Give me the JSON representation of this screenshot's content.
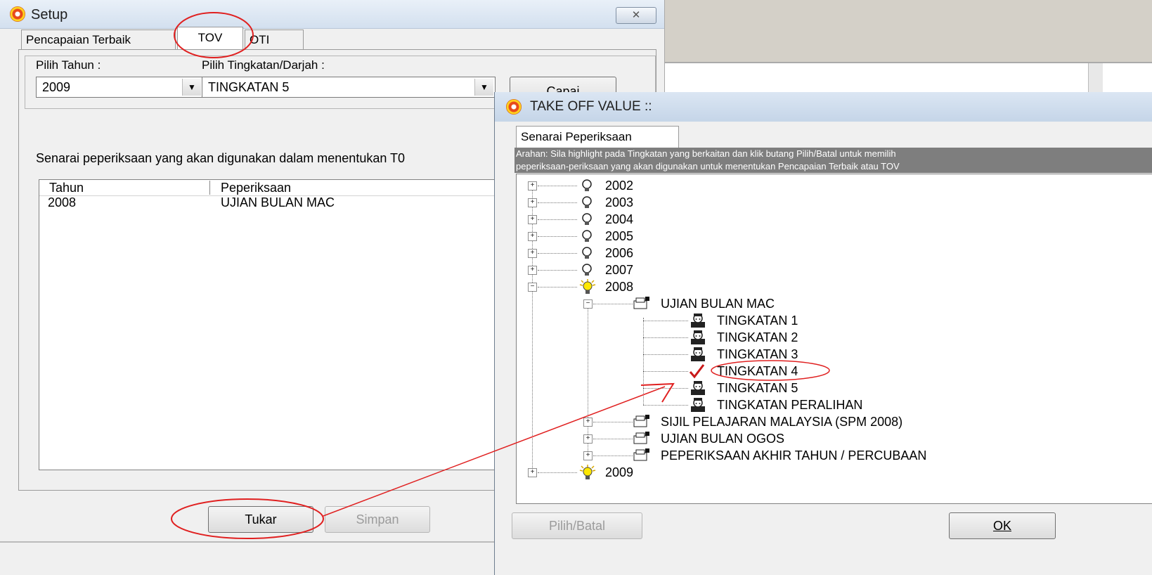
{
  "setup_window": {
    "title": "Setup",
    "close_symbol": "✕",
    "tabs": [
      "Pencapaian Terbaik",
      "TOV",
      "OTI"
    ],
    "active_tab": "TOV",
    "pilih_tahun_label": "Pilih Tahun :",
    "pilih_tahun_value": "2009",
    "pilih_tingkatan_label": "Pilih Tingkatan/Darjah  :",
    "pilih_tingkatan_value": "TINGKATAN 5",
    "capai_button": "Capai",
    "description": "Senarai peperiksaan yang akan digunakan dalam menentukan T0",
    "list_columns": [
      "Tahun",
      "Peperiksaan"
    ],
    "list_rows": [
      {
        "tahun": "2008",
        "peperiksaan": "UJIAN BULAN MAC"
      }
    ],
    "tukar_button": "Tukar",
    "simpan_button": "Simpan"
  },
  "dialog": {
    "title": "TAKE OFF VALUE ::",
    "tab": "Senarai Peperiksaan",
    "arahan_line1": "Arahan: Sila highlight pada Tingkatan yang berkaitan dan klik butang Pilih/Batal  untuk memilih",
    "arahan_line2": "peperiksaan-periksaan yang akan digunakan untuk menentukan Pencapaian Terbaik atau TOV",
    "tree": {
      "years": [
        "2002",
        "2003",
        "2004",
        "2005",
        "2006",
        "2007",
        "2008",
        "2009"
      ],
      "expanded_year": "2008",
      "exams": [
        "UJIAN BULAN MAC",
        "SIJIL PELAJARAN MALAYSIA (SPM 2008)",
        "UJIAN BULAN OGOS",
        "PEPERIKSAAN AKHIR TAHUN / PERCUBAAN"
      ],
      "expanded_exam": "UJIAN BULAN MAC",
      "levels": [
        "TINGKATAN 1",
        "TINGKATAN 2",
        "TINGKATAN 3",
        "TINGKATAN 4",
        "TINGKATAN 5",
        "TINGKATAN PERALIHAN"
      ],
      "checked_level": "TINGKATAN 4"
    },
    "pilih_batal_button": "Pilih/Batal",
    "ok_button": "OK",
    "ok_mnemonic": "O"
  },
  "icons": {
    "app_icon": "target-icon",
    "year_closed": "bulb-off-icon",
    "year_open": "bulb-on-icon",
    "exam": "exam-folder-icon",
    "level": "student-icon",
    "checked": "checkmark-icon"
  },
  "annotation_color": "#e02020"
}
